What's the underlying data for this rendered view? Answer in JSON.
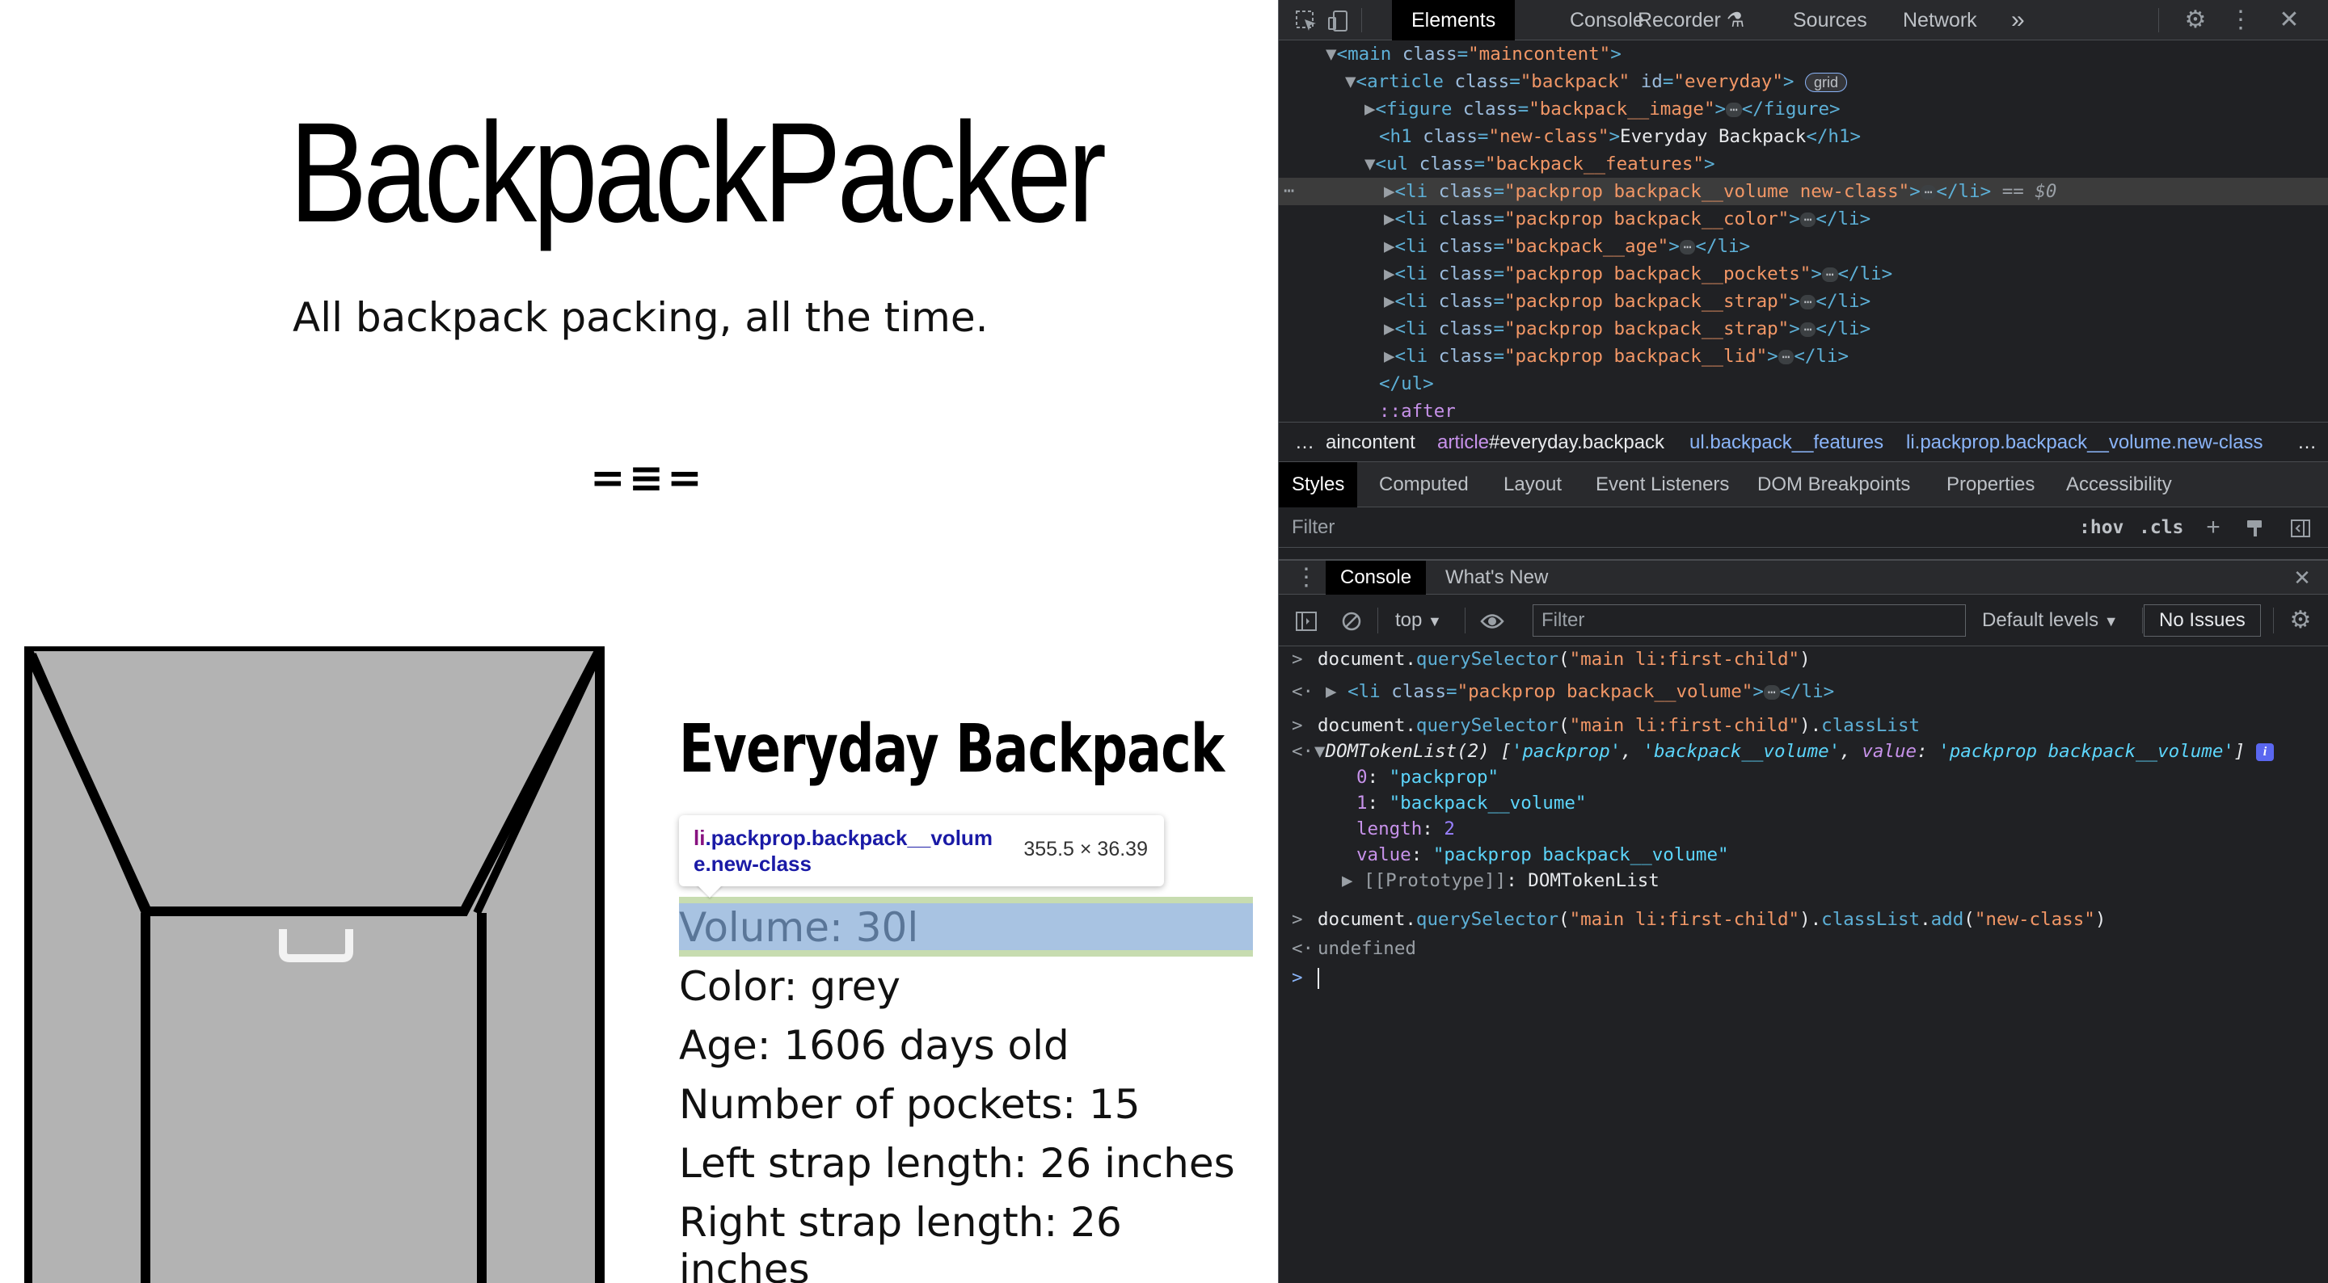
{
  "page": {
    "site_title": "BackpackPacker",
    "tagline": "All backpack packing, all the time.",
    "divider": "=≡=",
    "product_name": "Everyday Backpack",
    "tooltip": {
      "tag": "li",
      "selector": ".packprop.backpack__volume.new-class",
      "dims": "355.5 × 36.39"
    },
    "features": [
      "Volume: 30l",
      "Color: grey",
      "Age: 1606 days old",
      "Number of pockets: 15",
      "Left strap length: 26 inches",
      "Right strap length: 26",
      "inches"
    ]
  },
  "devtools": {
    "tabs": [
      "Elements",
      "Console",
      "Recorder",
      "Sources",
      "Network"
    ],
    "more_tabs": "»",
    "dom": {
      "main_open": "<main class=\"maincontent\">",
      "lines": {
        "main": {
          "tag_open": "<main",
          "attr": "class",
          "val": "\"maincontent\"",
          "close": ">"
        },
        "article": {
          "tag_open": "<article",
          "attr1": "class",
          "val1": "\"backpack\"",
          "attr2": "id",
          "val2": "\"everyday\"",
          "close": ">",
          "badge": "grid"
        },
        "figure": {
          "tag_open": "<figure",
          "attr": "class",
          "val": "\"backpack__image\"",
          "close": ">",
          "end": "</figure>"
        },
        "h1": {
          "tag_open": "<h1",
          "attr": "class",
          "val": "\"new-class\"",
          "close": ">",
          "text": "Everyday Backpack",
          "end": "</h1>"
        },
        "ul": {
          "tag_open": "<ul",
          "attr": "class",
          "val": "\"backpack__features\"",
          "close": ">"
        },
        "li_items": [
          {
            "val": "\"packprop backpack__volume new-class\"",
            "suffix": "== $0"
          },
          {
            "val": "\"packprop backpack__color\"",
            "suffix": ""
          },
          {
            "val": "\"backpack__age\"",
            "suffix": ""
          },
          {
            "val": "\"packprop backpack__pockets\"",
            "suffix": ""
          },
          {
            "val": "\"packprop backpack__strap\"",
            "suffix": ""
          },
          {
            "val": "\"packprop backpack__strap\"",
            "suffix": ""
          },
          {
            "val": "\"packprop backpack__lid\"",
            "suffix": ""
          }
        ],
        "li_open": "<li",
        "li_attr": "class",
        "li_close": ">",
        "li_end": "</li>",
        "ul_end": "</ul>",
        "after": "::after"
      }
    },
    "breadcrumbs": {
      "lead": "…",
      "c1": "aincontent",
      "c2_tag": "article",
      "c2_rest": "#everyday.backpack",
      "c3": "ul.backpack__features",
      "c4": "li.packprop.backpack__volume.new-class",
      "trail": "…"
    },
    "subtabs": [
      "Styles",
      "Computed",
      "Layout",
      "Event Listeners",
      "DOM Breakpoints",
      "Properties",
      "Accessibility"
    ],
    "styles_filter_placeholder": "Filter",
    "hov": ":hov",
    "cls": ".cls",
    "drawer_tabs": [
      "Console",
      "What's New"
    ],
    "console_bar": {
      "context": "top",
      "filter_placeholder": "Filter",
      "levels": "Default levels",
      "issues": "No Issues"
    },
    "console": {
      "l1": {
        "a": "document.",
        "b": "querySelector",
        "c": "(",
        "d": "\"main li:first-child\"",
        "e": ")"
      },
      "l2": {
        "open": "<li",
        "attr": "class",
        "val": "\"packprop backpack__volume\"",
        "close": ">",
        "end": "</li>"
      },
      "l3": {
        "a": "document.",
        "b": "querySelector",
        "c": "(",
        "d": "\"main li:first-child\"",
        "e": ").",
        "f": "classList"
      },
      "l4": {
        "head": "DOMTokenList(2) [",
        "s1": "'packprop'",
        "sep": ", ",
        "s2": "'backpack__volume'",
        "sep2": ", ",
        "k": "value",
        "colon": ": ",
        "s3": "'packprop backpack__volume'",
        "end": "]"
      },
      "l5": {
        "k": "0",
        "v": "\"packprop\""
      },
      "l6": {
        "k": "1",
        "v": "\"backpack__volume\""
      },
      "l7": {
        "k": "length",
        "v": "2"
      },
      "l8": {
        "k": "value",
        "v": "\"packprop backpack__volume\""
      },
      "l9": {
        "k": "[[Prototype]]",
        "v": "DOMTokenList"
      },
      "l10": {
        "a": "document.",
        "b": "querySelector",
        "c": "(",
        "d": "\"main li:first-child\"",
        "e": ").",
        "f": "classList",
        "g": ".",
        "h": "add",
        "i": "(",
        "j": "\"new-class\"",
        "k": ")"
      },
      "l11": "undefined"
    }
  }
}
